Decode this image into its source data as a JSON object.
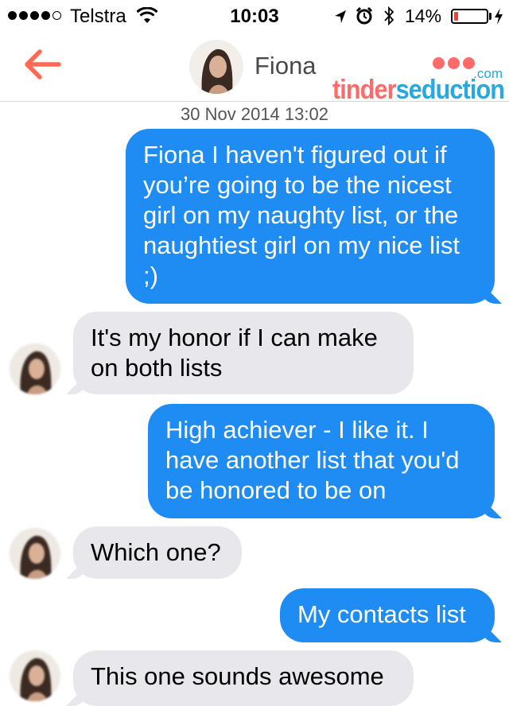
{
  "status_bar": {
    "carrier": "Telstra",
    "time": "10:03",
    "battery_percent": "14%",
    "battery_level": 0.14,
    "signal_bars_filled": 4,
    "signal_bars_total": 5
  },
  "nav": {
    "contact_name": "Fiona",
    "brand": {
      "word_left": "tinder",
      "word_right": "seduction",
      "suffix": ".com"
    }
  },
  "conversation": {
    "timestamp": "30 Nov 2014 13:02",
    "messages": [
      {
        "direction": "outgoing",
        "text": "Fiona I haven't figured out if you’re going to be the nicest girl on my naughty list, or the naughtiest girl on my nice list ;)"
      },
      {
        "direction": "incoming",
        "text": "It's my honor if I can make on both lists"
      },
      {
        "direction": "outgoing",
        "text": "High achiever - I like it. I have another list that you'd be honored to be on"
      },
      {
        "direction": "incoming",
        "text": "Which one?"
      },
      {
        "direction": "outgoing",
        "text": "My contacts list"
      },
      {
        "direction": "incoming",
        "text": "This one sounds awesome"
      }
    ]
  },
  "colors": {
    "outgoing_bubble": "#1e8cf3",
    "incoming_bubble": "#e7e7ec",
    "back_arrow": "#ff6a52",
    "brand_red": "#ff6a6a",
    "brand_blue": "#29a8df"
  }
}
